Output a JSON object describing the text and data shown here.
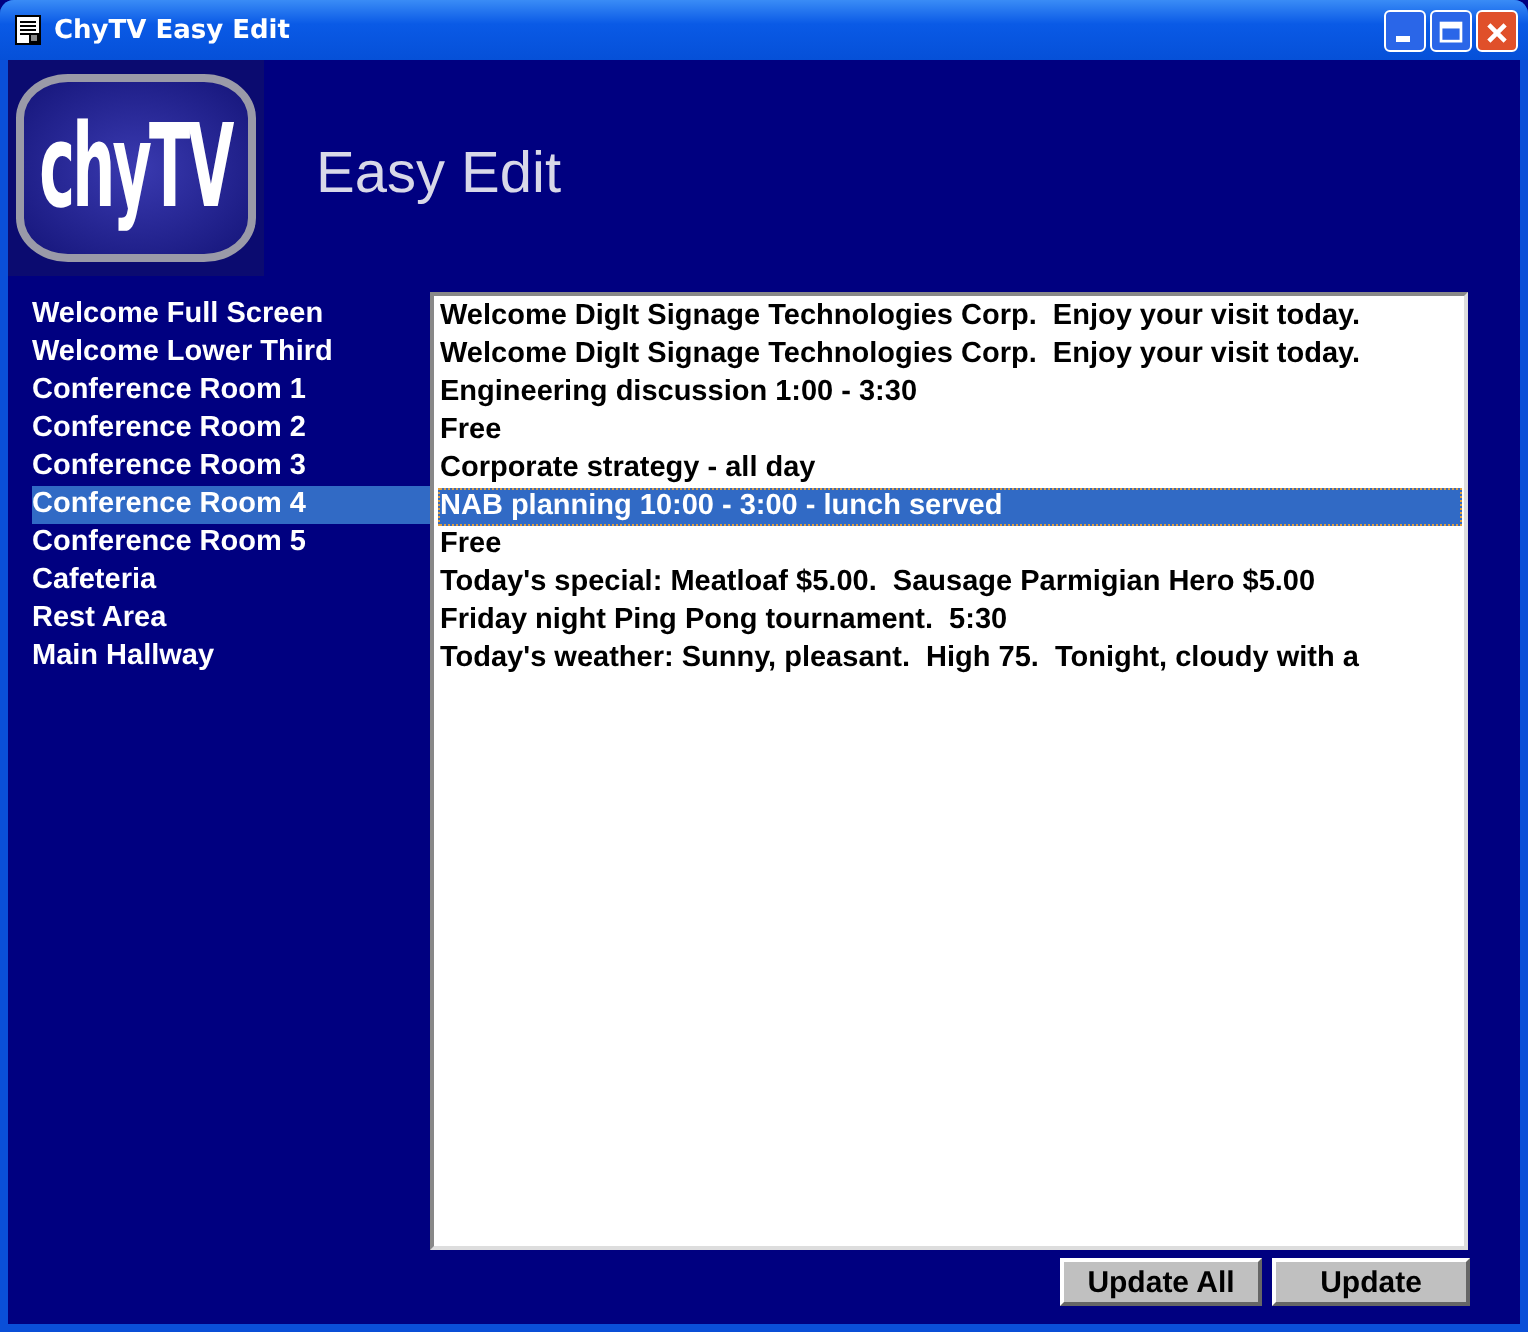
{
  "window": {
    "title": "ChyTV Easy Edit"
  },
  "header": {
    "logo": "chyTV",
    "title": "Easy Edit"
  },
  "locations": [
    {
      "label": "Welcome Full Screen",
      "selected": false
    },
    {
      "label": "Welcome Lower Third",
      "selected": false
    },
    {
      "label": "Conference Room 1",
      "selected": false
    },
    {
      "label": "Conference Room 2",
      "selected": false
    },
    {
      "label": "Conference Room 3",
      "selected": false
    },
    {
      "label": "Conference Room 4",
      "selected": true
    },
    {
      "label": "Conference Room 5",
      "selected": false
    },
    {
      "label": "Cafeteria",
      "selected": false
    },
    {
      "label": "Rest Area",
      "selected": false
    },
    {
      "label": "Main Hallway",
      "selected": false
    }
  ],
  "messages": [
    {
      "text": "Welcome DigIt Signage Technologies Corp.  Enjoy your visit today.",
      "selected": false
    },
    {
      "text": "Welcome DigIt Signage Technologies Corp.  Enjoy your visit today.",
      "selected": false
    },
    {
      "text": "Engineering discussion 1:00 - 3:30",
      "selected": false
    },
    {
      "text": "Free",
      "selected": false
    },
    {
      "text": "Corporate strategy - all day",
      "selected": false
    },
    {
      "text": "NAB planning 10:00 - 3:00 - lunch served",
      "selected": true
    },
    {
      "text": "Free",
      "selected": false
    },
    {
      "text": "Today's special: Meatloaf $5.00.  Sausage Parmigian Hero $5.00",
      "selected": false
    },
    {
      "text": "Friday night Ping Pong tournament.  5:30",
      "selected": false
    },
    {
      "text": "Today's weather: Sunny, pleasant.  High 75.  Tonight, cloudy with a",
      "selected": false
    }
  ],
  "buttons": [
    "Update All",
    "Update"
  ]
}
